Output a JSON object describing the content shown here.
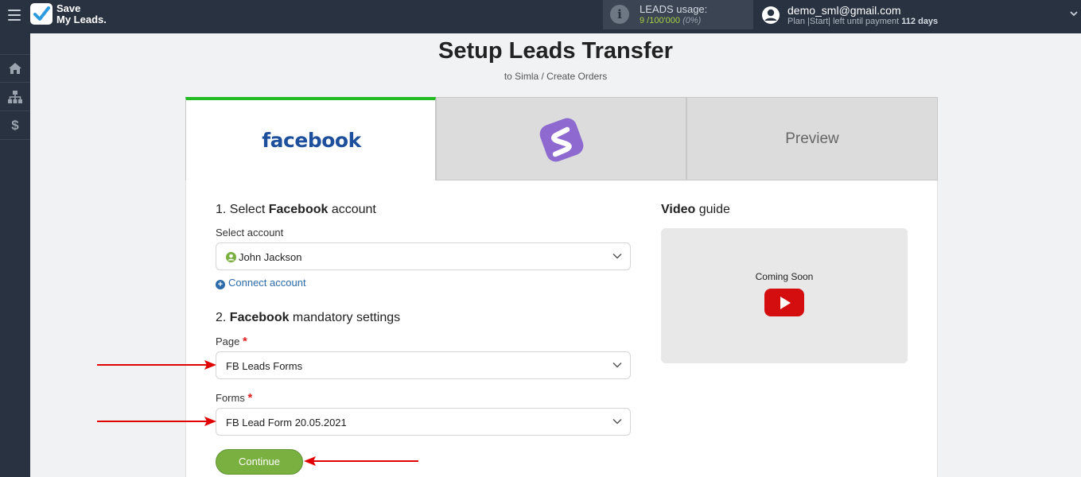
{
  "topbar": {
    "logo_line1": "Save",
    "logo_line2": "My Leads.",
    "usage_label": "LEADS usage:",
    "usage_value": "9 /100'000",
    "usage_percent": "(0%)",
    "user_email": "demo_sml@gmail.com",
    "plan_text": "Plan |Start| left until payment",
    "plan_days": "112 days"
  },
  "sidebar": {
    "items": [
      {
        "icon": "home-icon"
      },
      {
        "icon": "sitemap-icon"
      },
      {
        "icon": "dollar-icon",
        "glyph": "$"
      }
    ]
  },
  "page": {
    "title": "Setup Leads Transfer",
    "subtitle": "to Simla / Create Orders"
  },
  "tabs": [
    {
      "label": "facebook",
      "state": "active"
    },
    {
      "label": "",
      "icon": "simla-logo"
    },
    {
      "label": "Preview"
    }
  ],
  "form": {
    "step1_prefix": "1. Select ",
    "step1_bold": "Facebook",
    "step1_suffix": " account",
    "account_label": "Select account",
    "account_value": "John Jackson",
    "connect_label": "Connect account",
    "step2_prefix": "2. ",
    "step2_bold": "Facebook",
    "step2_suffix": " mandatory settings",
    "page_label": "Page",
    "page_value": "FB Leads Forms",
    "forms_label": "Forms",
    "forms_value": "FB Lead Form 20.05.2021",
    "required_mark": "*",
    "continue_label": "Continue"
  },
  "video": {
    "title_bold": "Video",
    "title_rest": " guide",
    "coming_soon": "Coming Soon"
  },
  "colors": {
    "topbar": "#283240",
    "active_tab_border": "#22bb22",
    "continue_button": "#79b040",
    "annotation_arrow": "#e00000",
    "link": "#2b6aa8"
  }
}
